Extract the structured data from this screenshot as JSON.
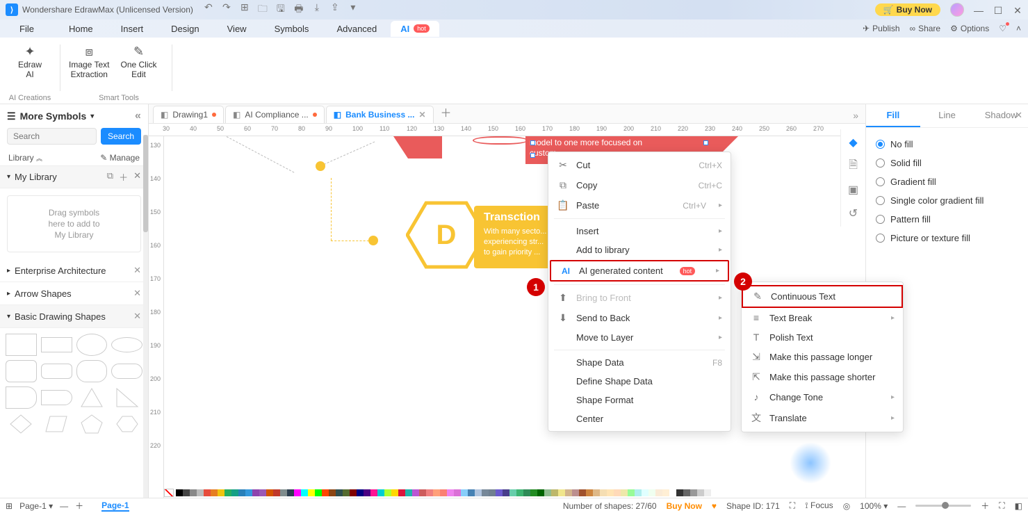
{
  "titlebar": {
    "app_title": "Wondershare EdrawMax (Unlicensed Version)",
    "buy_now": "Buy Now"
  },
  "menubar": {
    "items": [
      "File",
      "Home",
      "Insert",
      "Design",
      "View",
      "Symbols",
      "Advanced"
    ],
    "ai_tab": "AI",
    "hot": "hot",
    "right": {
      "publish": "Publish",
      "share": "Share",
      "options": "Options"
    }
  },
  "ribbon": {
    "group_ai": {
      "label": "AI Creations",
      "btn": {
        "label": "Edraw\nAI"
      }
    },
    "group_smart": {
      "label": "Smart Tools",
      "btn1": {
        "label": "Image Text\nExtraction"
      },
      "btn2": {
        "label": "One Click\nEdit"
      }
    }
  },
  "sidebar": {
    "title": "More Symbols",
    "search_placeholder": "Search",
    "search_btn": "Search",
    "library": "Library",
    "manage": "Manage",
    "mylib": "My Library",
    "dropzone": "Drag symbols\nhere to add to\nMy Library",
    "cats": [
      "Enterprise Architecture",
      "Arrow Shapes",
      "Basic Drawing Shapes"
    ]
  },
  "doctabs": {
    "t1": "Drawing1",
    "t2": "AI Compliance ...",
    "t3": "Bank Business ..."
  },
  "ruler_h": [
    "30",
    "40",
    "50",
    "60",
    "70",
    "80",
    "90",
    "100",
    "110",
    "120",
    "130",
    "140",
    "150",
    "160",
    "170",
    "180",
    "190",
    "200",
    "210",
    "220",
    "230",
    "240",
    "250",
    "260",
    "270"
  ],
  "ruler_v": [
    "130",
    "140",
    "150",
    "160",
    "170",
    "180",
    "190",
    "200",
    "210",
    "220"
  ],
  "diagram": {
    "red_text": "model to one more focused on\ncustom...",
    "d_letter": "D",
    "d_title": "Transction",
    "d_body": "With many secto...\nexperiencing str...\nto gain priority ..."
  },
  "ctx1": {
    "cut": "Cut",
    "cut_sc": "Ctrl+X",
    "copy": "Copy",
    "copy_sc": "Ctrl+C",
    "paste": "Paste",
    "paste_sc": "Ctrl+V",
    "insert": "Insert",
    "addlib": "Add to library",
    "ai": "AI generated content",
    "btf": "Bring to Front",
    "stb": "Send to Back",
    "layer": "Move to Layer",
    "sd": "Shape Data",
    "sd_sc": "F8",
    "dsd": "Define Shape Data",
    "sf": "Shape Format",
    "center": "Center"
  },
  "ctx2": {
    "ct": "Continuous Text",
    "tb": "Text Break",
    "pt": "Polish Text",
    "longer": "Make this passage longer",
    "shorter": "Make this passage shorter",
    "tone": "Change Tone",
    "tr": "Translate"
  },
  "rightpanel": {
    "tabs": [
      "Fill",
      "Line",
      "Shadow"
    ],
    "opts": [
      "No fill",
      "Solid fill",
      "Gradient fill",
      "Single color gradient fill",
      "Pattern fill",
      "Picture or texture fill"
    ]
  },
  "status": {
    "page": "Page-1",
    "page_active": "Page-1",
    "shapes": "Number of shapes: 27/60",
    "buy": "Buy Now",
    "shapeid": "Shape ID: 171",
    "focus": "Focus",
    "zoom": "100%"
  },
  "colors": [
    "#000",
    "#444",
    "#888",
    "#bbb",
    "#e74c3c",
    "#e67e22",
    "#f1c40f",
    "#27ae60",
    "#16a085",
    "#2980b9",
    "#3498db",
    "#8e44ad",
    "#9b59b6",
    "#d35400",
    "#c0392b",
    "#7f8c8d",
    "#2c3e50",
    "#ff00ff",
    "#00ffff",
    "#ffff00",
    "#00ff00",
    "#ff4500",
    "#8b4513",
    "#2f4f4f",
    "#556b2f",
    "#800000",
    "#000080",
    "#4b0082",
    "#ff1493",
    "#00ced1",
    "#adff2f",
    "#ffd700",
    "#dc143c",
    "#20b2aa",
    "#ba55d3",
    "#cd5c5c",
    "#f08080",
    "#ffa07a",
    "#fa8072",
    "#ee82ee",
    "#da70d6",
    "#87cefa",
    "#4682b4",
    "#b0c4de",
    "#778899",
    "#708090",
    "#6a5acd",
    "#483d8b",
    "#66cdaa",
    "#3cb371",
    "#2e8b57",
    "#228b22",
    "#006400",
    "#8fbc8f",
    "#bdb76b",
    "#f0e68c",
    "#d2b48c",
    "#bc8f8f",
    "#a0522d",
    "#cd853f",
    "#deb887",
    "#f5deb3",
    "#ffe4b5",
    "#ffdab9",
    "#eee8aa",
    "#98fb98",
    "#afeeee",
    "#e0ffff",
    "#f0fff0",
    "#faebd7",
    "#ffefd5",
    "#fff",
    "#333",
    "#666",
    "#999",
    "#ccc",
    "#eee"
  ]
}
